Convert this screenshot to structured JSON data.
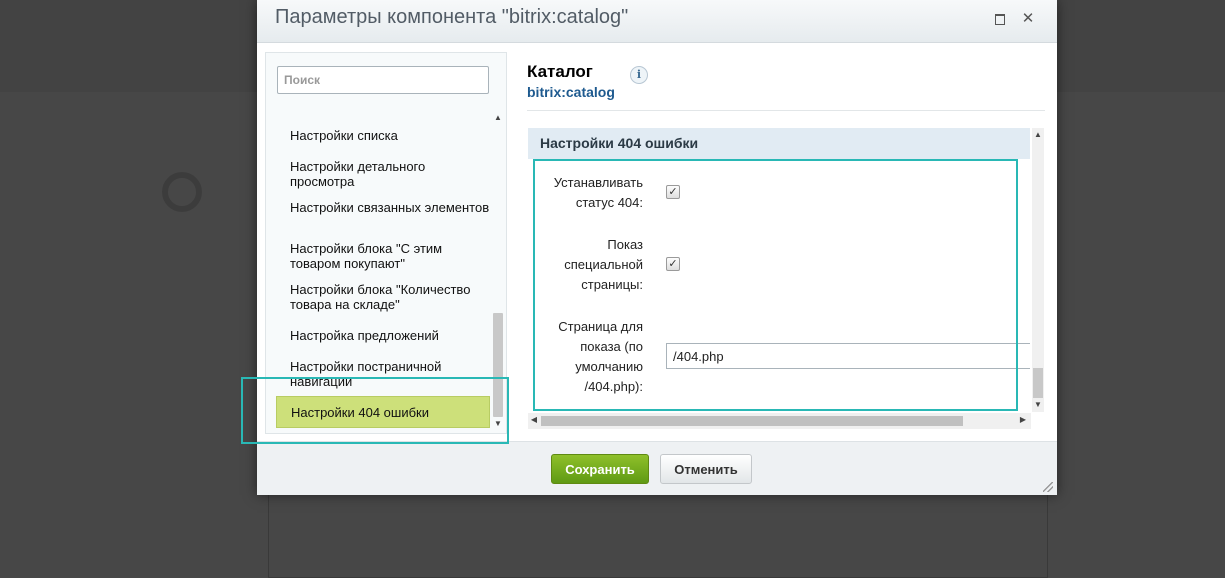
{
  "dialog": {
    "title": "Параметры компонента \"bitrix:catalog\"",
    "maximize_icon": "maximize-icon",
    "close_glyph": "✕"
  },
  "search": {
    "placeholder": "Поиск"
  },
  "sidebar": {
    "items": [
      {
        "label": "Настройки списка",
        "active": false
      },
      {
        "label": "Настройки детального просмотра",
        "active": false
      },
      {
        "label": "Настройки связанных элементов",
        "active": false
      },
      {
        "label": "Настройки блока \"С этим товаром покупают\"",
        "active": false
      },
      {
        "label": "Настройки блока \"Количество товара на складе\"",
        "active": false
      },
      {
        "label": "Настройка предложений",
        "active": false
      },
      {
        "label": "Настройки постраничной навигации",
        "active": false
      },
      {
        "label": "Настройки 404 ошибки",
        "active": true
      }
    ],
    "active_color": "#cde07a"
  },
  "component": {
    "name": "Каталог",
    "code": "bitrix:catalog",
    "info_glyph": "i"
  },
  "section": {
    "title": "Настройки 404 ошибки",
    "fields": {
      "set_status": {
        "label": "Устанавливать статус 404:",
        "checked": true
      },
      "show_page": {
        "label": "Показ специальной страницы:",
        "checked": true
      },
      "page_url": {
        "label": "Страница для показа (по умолчанию /404.php):",
        "value": "/404.php"
      }
    }
  },
  "footer": {
    "save_label": "Сохранить",
    "cancel_label": "Отменить"
  },
  "colors": {
    "accent_highlight": "#29b8b5",
    "save_button": "#6fa81c",
    "section_header": "#e1ebf3"
  }
}
